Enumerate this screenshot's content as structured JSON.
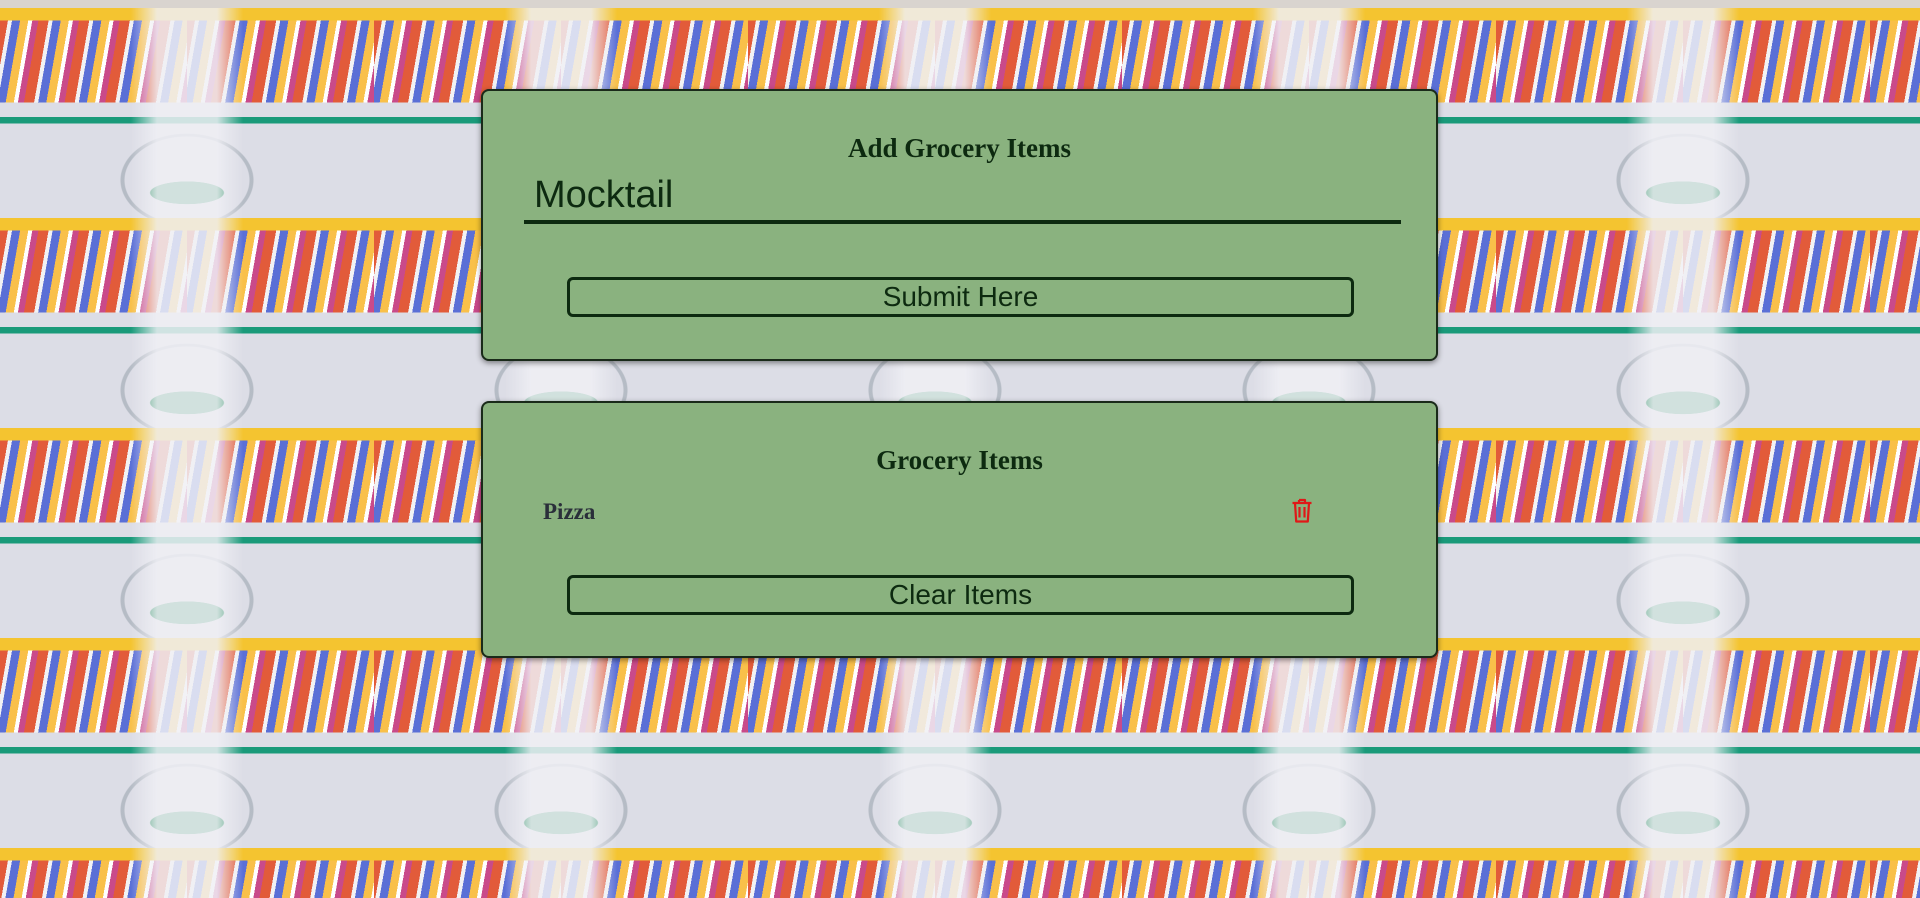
{
  "add_card": {
    "title": "Add Grocery Items",
    "input_value": "Mocktail",
    "submit_label": "Submit Here"
  },
  "list_card": {
    "title": "Grocery Items",
    "items": [
      {
        "name": "Pizza",
        "delete_icon": "trash-icon"
      }
    ],
    "clear_label": "Clear Items"
  },
  "colors": {
    "card_background": "#8ab27f",
    "text_dark": "#0d2a10",
    "delete_icon": "#e01818"
  },
  "background": {
    "image": "supermarket-aisle-cart"
  }
}
